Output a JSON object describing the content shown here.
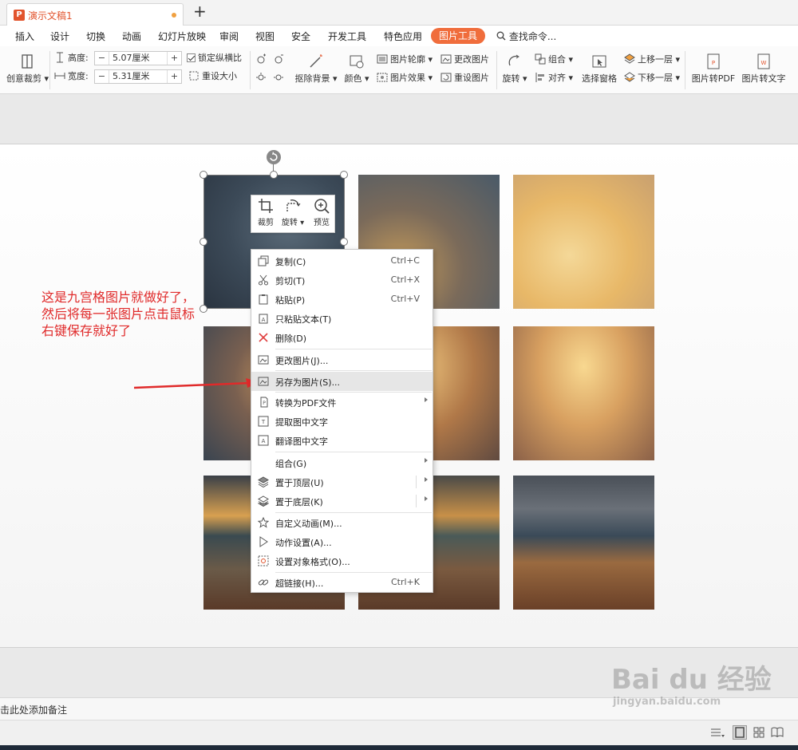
{
  "titlebar": {
    "doc_title": "演示文稿1",
    "logo_glyph": "P"
  },
  "menu": {
    "items": [
      "插入",
      "设计",
      "切换",
      "动画",
      "幻灯片放映",
      "审阅",
      "视图",
      "安全",
      "开发工具",
      "特色应用"
    ],
    "active": "图片工具",
    "search": "查找命令..."
  },
  "ribbon": {
    "crop": "创意裁剪",
    "height_label": "高度:",
    "height_value": "5.07厘米",
    "width_label": "宽度:",
    "width_value": "5.31厘米",
    "lock_ratio": "锁定纵横比",
    "reset_size": "重设大小",
    "remove_bg": "抠除背景",
    "color": "颜色",
    "outline": "图片轮廓",
    "effect": "图片效果",
    "change_pic": "更改图片",
    "reset_pic": "重设图片",
    "rotate": "旋转",
    "group": "组合",
    "align": "对齐",
    "select_pane": "选择窗格",
    "bring_forward": "上移一层",
    "send_backward": "下移一层",
    "to_pdf": "图片转PDF",
    "to_text": "图片转文字"
  },
  "float_toolbar": {
    "crop": "裁剪",
    "rotate": "旋转",
    "preview": "预览"
  },
  "annotation": "这是九宫格图片就做好了，\n然后将每一张图片点击鼠标\n右键保存就好了",
  "context_menu": {
    "copy": "复制(C)",
    "copy_key": "Ctrl+C",
    "cut": "剪切(T)",
    "cut_key": "Ctrl+X",
    "paste": "粘贴(P)",
    "paste_key": "Ctrl+V",
    "paste_text": "只粘贴文本(T)",
    "delete": "删除(D)",
    "change_pic": "更改图片(J)...",
    "save_as_pic": "另存为图片(S)...",
    "to_pdf": "转换为PDF文件",
    "extract_text": "提取图中文字",
    "translate_text": "翻译图中文字",
    "group": "组合(G)",
    "bring_front": "置于顶层(U)",
    "send_back": "置于底层(K)",
    "custom_anim": "自定义动画(M)...",
    "action": "动作设置(A)...",
    "format": "设置对象格式(O)...",
    "hyperlink": "超链接(H)...",
    "hyperlink_key": "Ctrl+K"
  },
  "notes": "击此处添加备注",
  "watermark": {
    "brand": "Bai du 经验",
    "url": "jingyan.baidu.com"
  }
}
